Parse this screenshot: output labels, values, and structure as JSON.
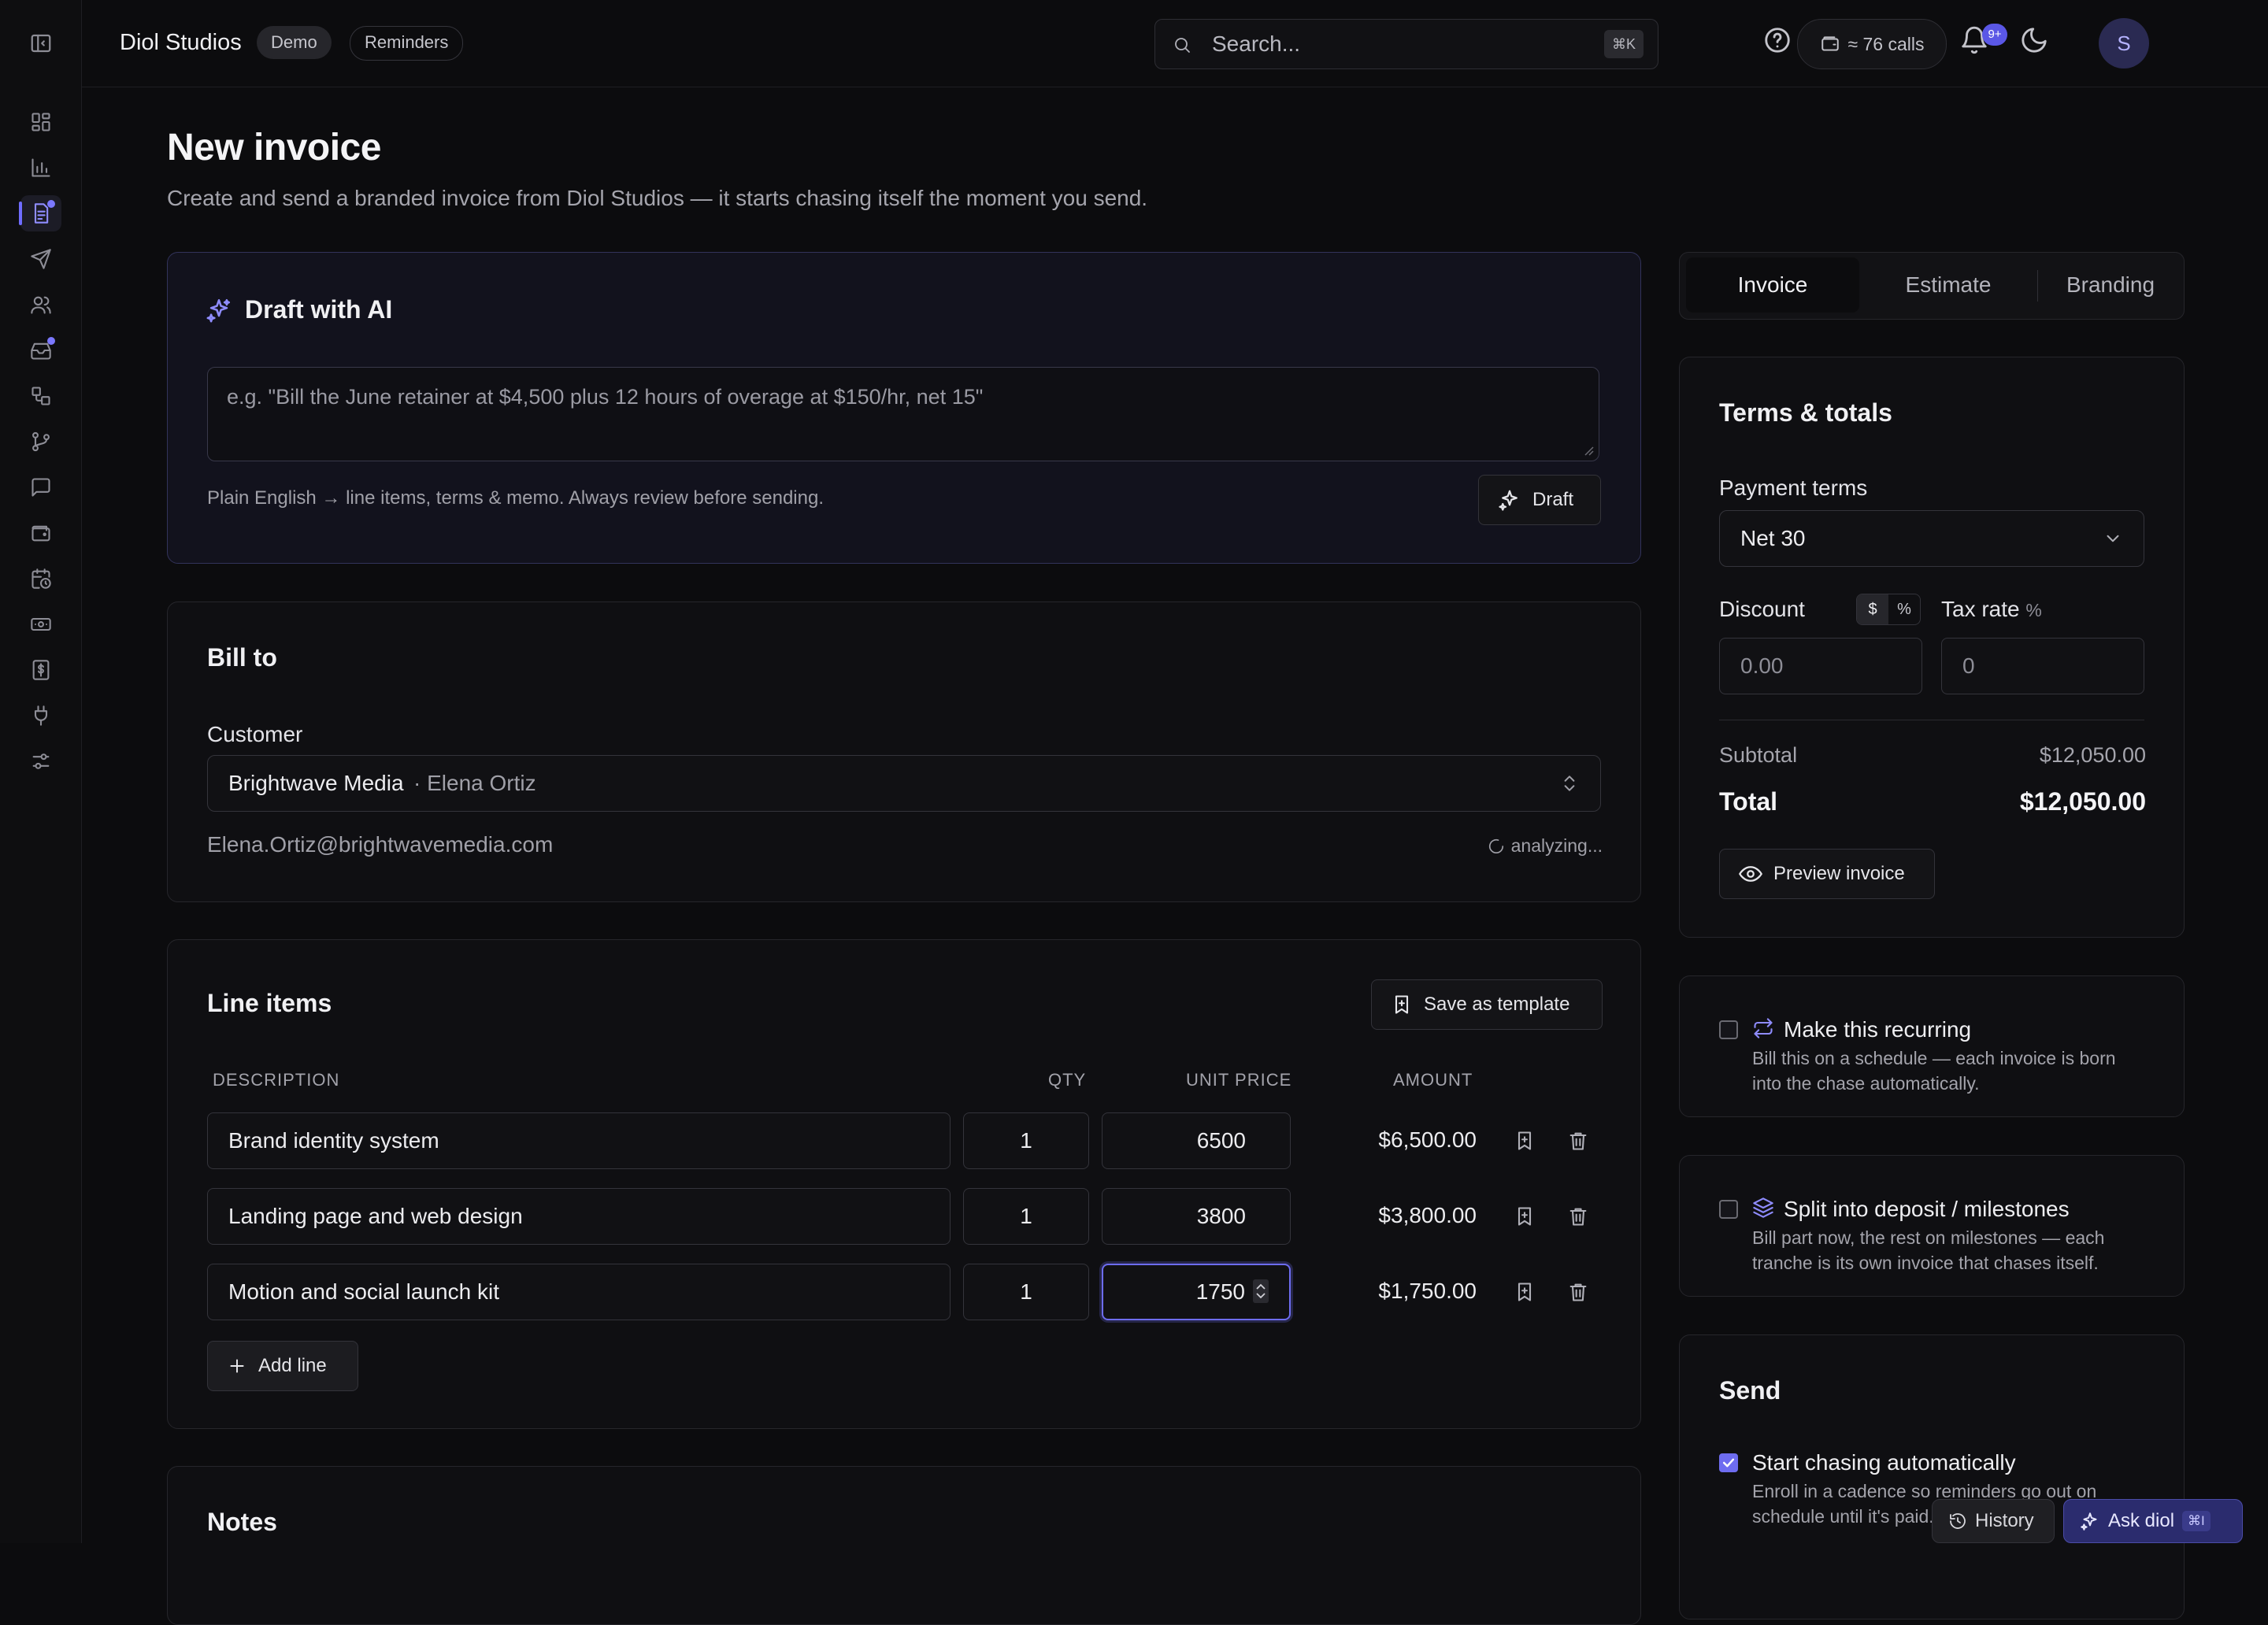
{
  "app": {
    "brand": "Diol Studios",
    "tags": [
      "Demo",
      "Reminders"
    ],
    "search_placeholder": "Search...",
    "search_shortcut": "⌘K",
    "calls": "≈ 76 calls",
    "notifications_badge": "9+",
    "avatar_initial": "S",
    "accent": "#6f6cff"
  },
  "page": {
    "title": "New invoice",
    "subtitle": "Create and send a branded invoice from Diol Studios — it starts chasing itself the moment you send."
  },
  "ai_draft": {
    "title": "Draft with AI",
    "placeholder": "e.g. \"Bill the June retainer at $4,500 plus 12 hours of overage at $150/hr, net 15\"",
    "hint": "Plain English → line items, terms & memo. Always review before sending.",
    "button": "Draft"
  },
  "bill_to": {
    "title": "Bill to",
    "customer_label": "Customer",
    "customer_company": "Brightwave Media",
    "customer_contact": "· Elena Ortiz",
    "email": "Elena.Ortiz@brightwavemedia.com",
    "status": "analyzing..."
  },
  "line_items": {
    "title": "Line items",
    "save_template": "Save as template",
    "columns": {
      "description": "DESCRIPTION",
      "qty": "QTY",
      "unit_price": "UNIT PRICE",
      "amount": "AMOUNT"
    },
    "rows": [
      {
        "description": "Brand identity system",
        "qty": "1",
        "unit_price": "6500",
        "amount": "$6,500.00"
      },
      {
        "description": "Landing page and web design",
        "qty": "1",
        "unit_price": "3800",
        "amount": "$3,800.00"
      },
      {
        "description": "Motion and social launch kit",
        "qty": "1",
        "unit_price": "1750",
        "amount": "$1,750.00"
      }
    ],
    "add_line": "Add line"
  },
  "notes": {
    "title": "Notes"
  },
  "tabs": [
    "Invoice",
    "Estimate",
    "Branding"
  ],
  "terms": {
    "title": "Terms & totals",
    "payment_terms_label": "Payment terms",
    "payment_terms_value": "Net 30",
    "discount_label": "Discount",
    "discount_modes": [
      "$",
      "%"
    ],
    "tax_label": "Tax rate",
    "tax_unit": "%",
    "discount_placeholder": "0.00",
    "tax_placeholder": "0",
    "subtotal_label": "Subtotal",
    "subtotal_value": "$12,050.00",
    "total_label": "Total",
    "total_value": "$12,050.00",
    "preview_button": "Preview invoice"
  },
  "recurring": {
    "title": "Make this recurring",
    "description": "Bill this on a schedule — each invoice is born into the chase automatically."
  },
  "split": {
    "title": "Split into deposit / milestones",
    "description": "Bill part now, the rest on milestones — each tranche is its own invoice that chases itself."
  },
  "send": {
    "title": "Send",
    "chase_title": "Start chasing automatically",
    "chase_description": "Enroll in a cadence so reminders go out on schedule until it's paid."
  },
  "floating": {
    "history": "History",
    "ask": "Ask diol",
    "ask_shortcut": "⌘I"
  }
}
